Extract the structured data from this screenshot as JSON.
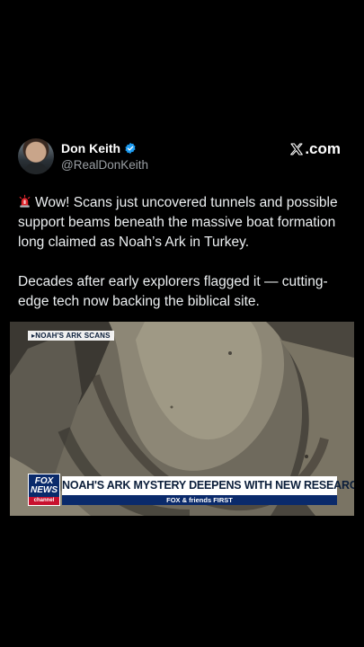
{
  "post": {
    "display_name": "Don Keith",
    "handle": "@RealDonKeith",
    "site_label": ".com",
    "paragraph_1": "Wow! Scans just uncovered tunnels and possible support beams beneath the massive boat formation long claimed as Noah’s Ark in Turkey.",
    "paragraph_2": "Decades after early explorers flagged it — cutting-edge tech now backing the biblical site."
  },
  "media": {
    "tag": "▸NOAH'S ARK SCANS",
    "network_top": "FOX",
    "network_mid": "NEWS",
    "network_bottom": "channel",
    "headline": "NOAH'S ARK MYSTERY DEEPENS WITH NEW RESEARCH",
    "show": "FOX & friends FIRST"
  },
  "colors": {
    "background": "#000000",
    "verified": "#1d9bf0",
    "fox_blue": "#0a2a6b",
    "fox_red": "#c8102e"
  },
  "icons": {
    "verified": "verified-badge-icon",
    "siren": "siren-emoji-icon",
    "x_logo": "x-logo-icon"
  }
}
